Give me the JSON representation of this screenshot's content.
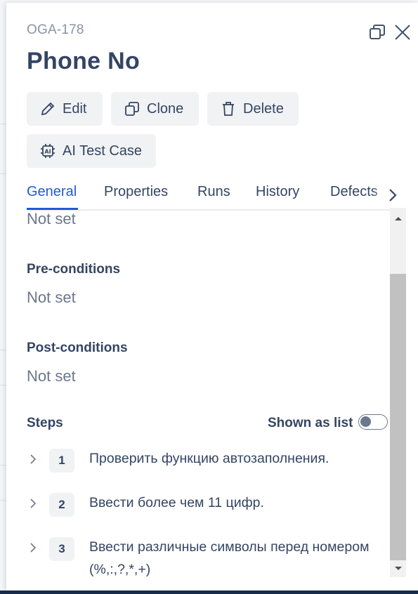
{
  "issue": {
    "key": "OGA-178",
    "title": "Phone No"
  },
  "actions": {
    "edit": "Edit",
    "clone": "Clone",
    "delete": "Delete",
    "ai_test_case": "AI Test Case"
  },
  "tabs": [
    {
      "label": "General",
      "active": true
    },
    {
      "label": "Properties",
      "active": false
    },
    {
      "label": "Runs",
      "active": false
    },
    {
      "label": "History",
      "active": false
    },
    {
      "label": "Defects",
      "active": false
    }
  ],
  "general": {
    "top_value": "Not set",
    "preconditions": {
      "label": "Pre-conditions",
      "value": "Not set"
    },
    "postconditions": {
      "label": "Post-conditions",
      "value": "Not set"
    },
    "steps": {
      "label": "Steps",
      "toggle_label": "Shown as list",
      "toggle_on": false,
      "items": [
        {
          "number": "1",
          "text": "Проверить функцию автозаполнения."
        },
        {
          "number": "2",
          "text": "Ввести более чем 11 цифр."
        },
        {
          "number": "3",
          "text": "Ввести различные символы перед номером (%,:,?,*,+)"
        }
      ]
    }
  },
  "colors": {
    "accent": "#1f5bd3",
    "text": "#344563",
    "muted": "#6b778c",
    "button_bg": "#f1f2f4"
  },
  "icons": [
    "restore-window-icon",
    "close-icon",
    "pencil-icon",
    "copy-icon",
    "trash-icon",
    "ai-chip-icon",
    "chevron-right-icon"
  ]
}
